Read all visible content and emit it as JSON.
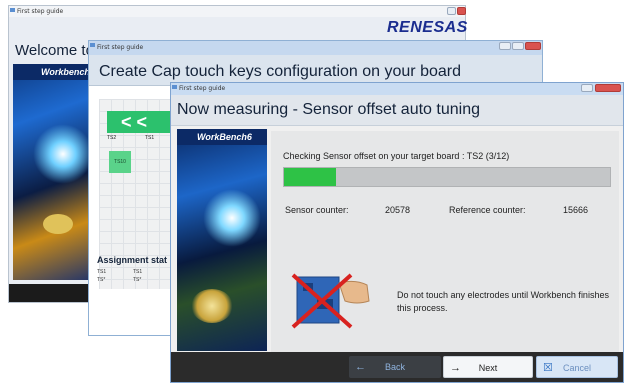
{
  "window1": {
    "title": "First step guide",
    "logo": "RENESAS",
    "heading": "Welcome to",
    "strip_text": "Workbench"
  },
  "window2": {
    "title": "First step guide",
    "heading": "Create Cap touch keys configuration on your board",
    "arrow_glyphs": "< <",
    "ts_labels": [
      "TS2",
      "TS1"
    ],
    "key_label": "TS10",
    "assignment_title": "Assignment stat",
    "assignment_rows": [
      [
        "TS1",
        "TS1"
      ],
      [
        "TS*",
        "TS*"
      ]
    ]
  },
  "window3": {
    "title": "First step guide",
    "heading": "Now measuring - Sensor offset auto tuning",
    "brand": "WorkBench6",
    "status_text": "Checking Sensor offset on your target board : TS2 (3/12)",
    "progress": 0.16,
    "sensor_counter_label": "Sensor counter:",
    "sensor_counter_value": "20578",
    "reference_counter_label": "Reference counter:",
    "reference_counter_value": "15666",
    "notice": "Do not touch any electrodes until Workbench finishes this process.",
    "buttons": {
      "back": "Back",
      "next": "Next",
      "cancel": "Cancel"
    }
  },
  "colors": {
    "progress": "#2ec246",
    "logo": "#1b2d8f",
    "footer": "#2b2b2b"
  },
  "icons": [
    "back-arrow-icon",
    "next-arrow-icon",
    "cancel-icon",
    "do-not-touch-icon"
  ]
}
